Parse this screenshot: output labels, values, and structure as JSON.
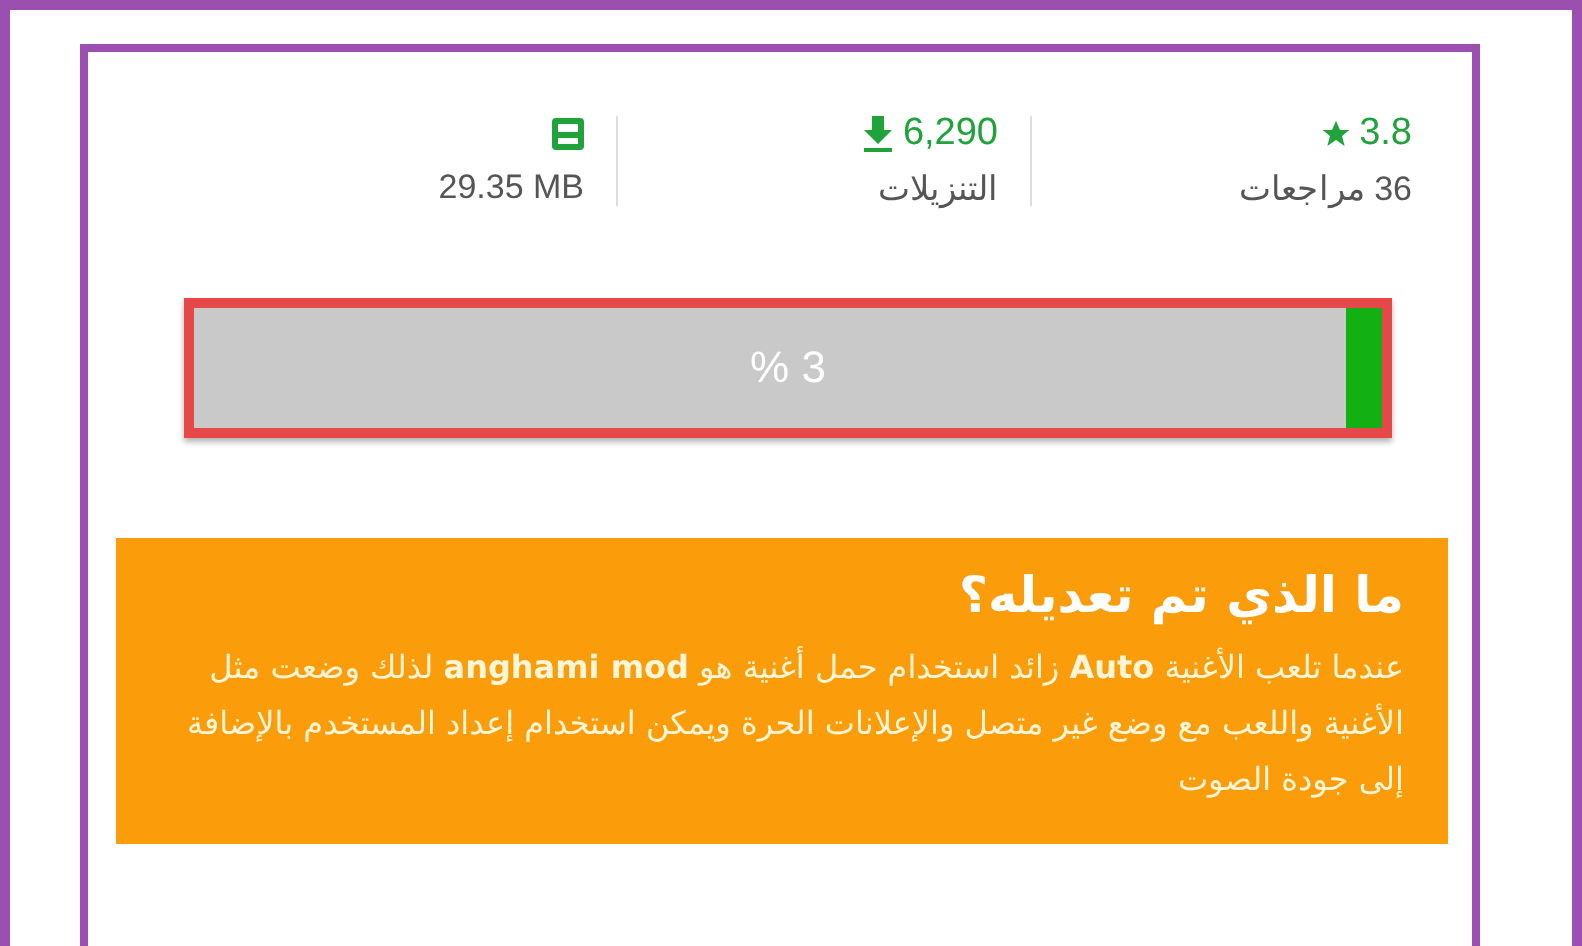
{
  "stats": [
    {
      "kind": "rating",
      "value": "3.8",
      "label": "36 مراجعات"
    },
    {
      "kind": "downloads",
      "value": "6,290",
      "label": "التنزيلات"
    },
    {
      "kind": "size",
      "label": "29.35 MB"
    }
  ],
  "progress": {
    "level": 0.03,
    "reading": "% 3",
    "highlighted": true
  },
  "changes": {
    "title": "ما الذي تم تعديله؟",
    "body": "عندما تلعب الأغنية **Auto** زائد استخدام حمل أغنية هو **anghami mod** لذلك وضعت مثل الأغنية واللعب مع وضع غير متصل والإعلانات الحرة ويمكن استخدام إعداد المستخدم بالإضافة إلى جودة الصوت"
  }
}
